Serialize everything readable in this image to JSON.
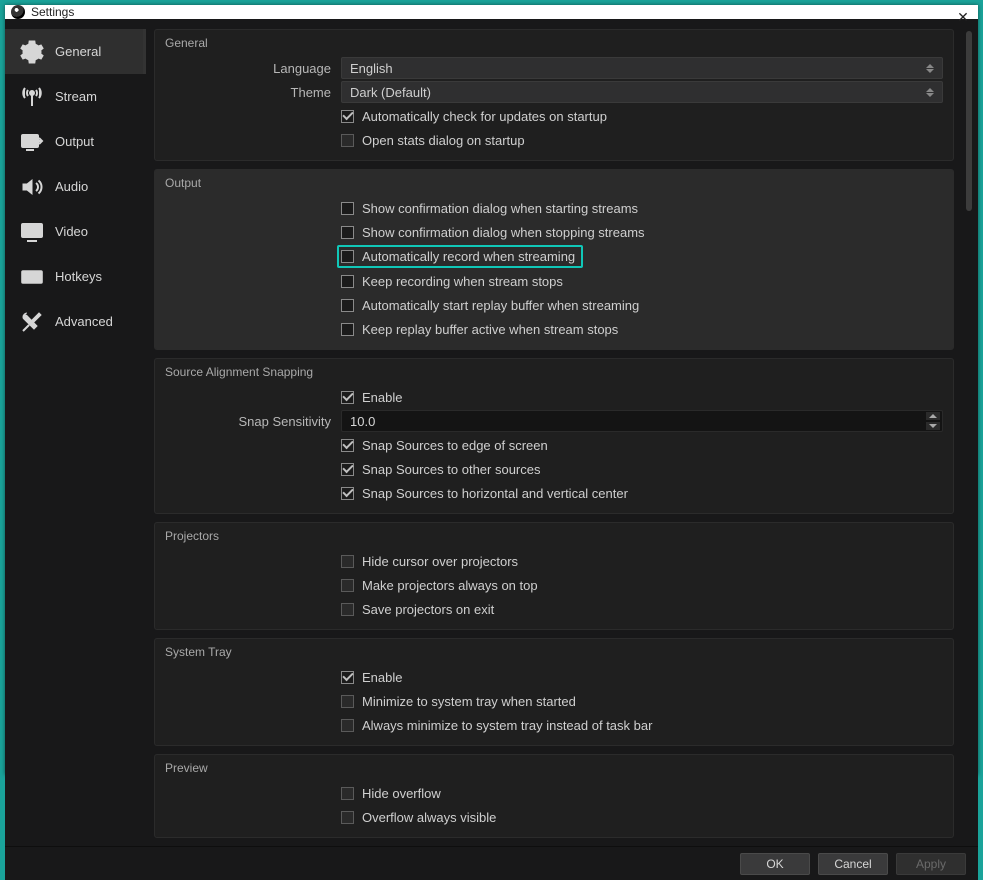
{
  "window": {
    "title": "Settings"
  },
  "sidebar": {
    "items": [
      {
        "label": "General"
      },
      {
        "label": "Stream"
      },
      {
        "label": "Output"
      },
      {
        "label": "Audio"
      },
      {
        "label": "Video"
      },
      {
        "label": "Hotkeys"
      },
      {
        "label": "Advanced"
      }
    ]
  },
  "sections": {
    "general": {
      "title": "General",
      "language_label": "Language",
      "language_value": "English",
      "theme_label": "Theme",
      "theme_value": "Dark (Default)",
      "auto_update": "Automatically check for updates on startup",
      "open_stats": "Open stats dialog on startup"
    },
    "output": {
      "title": "Output",
      "confirm_start": "Show confirmation dialog when starting streams",
      "confirm_stop": "Show confirmation dialog when stopping streams",
      "auto_record": "Automatically record when streaming",
      "keep_recording": "Keep recording when stream stops",
      "auto_replay": "Automatically start replay buffer when streaming",
      "keep_replay": "Keep replay buffer active when stream stops"
    },
    "snapping": {
      "title": "Source Alignment Snapping",
      "enable": "Enable",
      "sensitivity_label": "Snap Sensitivity",
      "sensitivity_value": "10.0",
      "edge": "Snap Sources to edge of screen",
      "others": "Snap Sources to other sources",
      "center": "Snap Sources to horizontal and vertical center"
    },
    "projectors": {
      "title": "Projectors",
      "hide_cursor": "Hide cursor over projectors",
      "always_top": "Make projectors always on top",
      "save_exit": "Save projectors on exit"
    },
    "tray": {
      "title": "System Tray",
      "enable": "Enable",
      "minimize_start": "Minimize to system tray when started",
      "always_minimize": "Always minimize to system tray instead of task bar"
    },
    "preview": {
      "title": "Preview",
      "hide_overflow": "Hide overflow",
      "overflow_visible": "Overflow always visible"
    }
  },
  "footer": {
    "ok": "OK",
    "cancel": "Cancel",
    "apply": "Apply"
  }
}
